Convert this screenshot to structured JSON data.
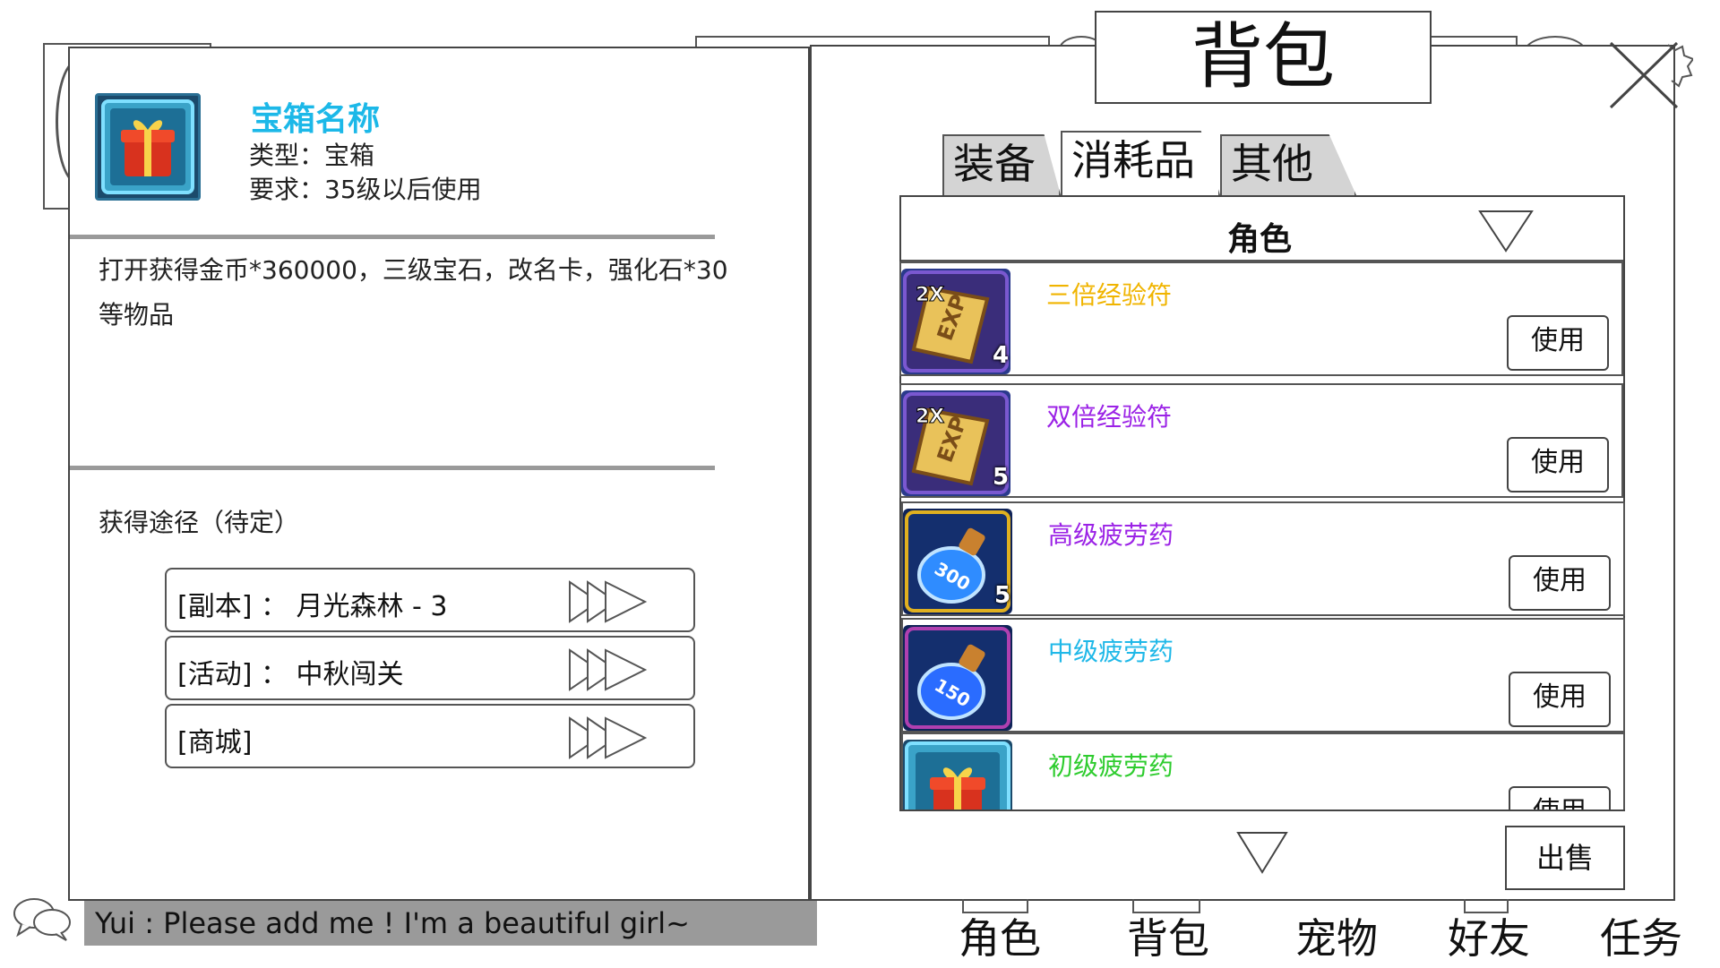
{
  "title": "背包",
  "item_detail": {
    "name": "宝箱名称",
    "type_line": "类型：宝箱",
    "requirement_line": "要求：35级以后使用",
    "description_line1": "打开获得金币*360000，三级宝石，改名卡，强化石*30",
    "description_line2": "等物品",
    "source_heading": "获得途径（待定）",
    "sources": [
      {
        "label": "[副本] ： 月光森林 - 3"
      },
      {
        "label": "[活动] ： 中秋闯关"
      },
      {
        "label": "[商城]"
      }
    ]
  },
  "tabs": [
    {
      "label": "装备",
      "active": false
    },
    {
      "label": "消耗品",
      "active": true
    },
    {
      "label": "其他",
      "active": false
    }
  ],
  "filter": {
    "selected": "角色"
  },
  "items": [
    {
      "name": "三倍经验符",
      "qty": "4",
      "color": "#f0b400",
      "icon": "exp-scroll-icon",
      "use_label": "使用"
    },
    {
      "name": "双倍经验符",
      "qty": "5",
      "color": "#9b22e6",
      "icon": "exp-scroll-icon",
      "use_label": "使用"
    },
    {
      "name": "高级疲劳药",
      "qty": "5",
      "color": "#9b22e6",
      "icon": "potion-300-icon",
      "use_label": "使用"
    },
    {
      "name": "中级疲劳药",
      "qty": "",
      "color": "#1fb8e8",
      "icon": "potion-150-icon",
      "use_label": "使用"
    },
    {
      "name": "初级疲劳药",
      "qty": "",
      "color": "#2ecc2e",
      "icon": "gift-box-icon",
      "use_label": "使用"
    }
  ],
  "sell_label": "出售",
  "chat": {
    "message": "Yui : Please add me ! I'm a beautiful girl~"
  },
  "bottom_nav": [
    {
      "label": "角色"
    },
    {
      "label": "背包"
    },
    {
      "label": "宠物"
    },
    {
      "label": "好友"
    },
    {
      "label": "任务"
    }
  ]
}
